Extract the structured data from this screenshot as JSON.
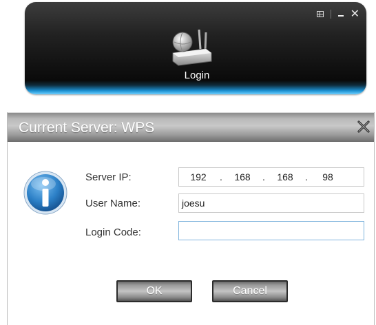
{
  "top_panel": {
    "login_label": "Login",
    "controls": {
      "restore_icon": "grid-icon",
      "minimize_icon": "minimize-icon",
      "close_icon": "close-icon"
    }
  },
  "dialog": {
    "title": "Current Server: WPS",
    "fields": {
      "server_ip": {
        "label": "Server IP:",
        "octets": [
          "192",
          "168",
          "168",
          "98"
        ]
      },
      "user_name": {
        "label": "User Name:",
        "value": "joesu"
      },
      "login_code": {
        "label": "Login Code:",
        "value": ""
      }
    },
    "buttons": {
      "ok_label": "OK",
      "cancel_label": "Cancel"
    }
  },
  "colors": {
    "panel_dark": "#111111",
    "panel_glow": "#1b8fd0",
    "info_blue": "#1f6fb8",
    "field_focus": "#7fb4dd"
  }
}
